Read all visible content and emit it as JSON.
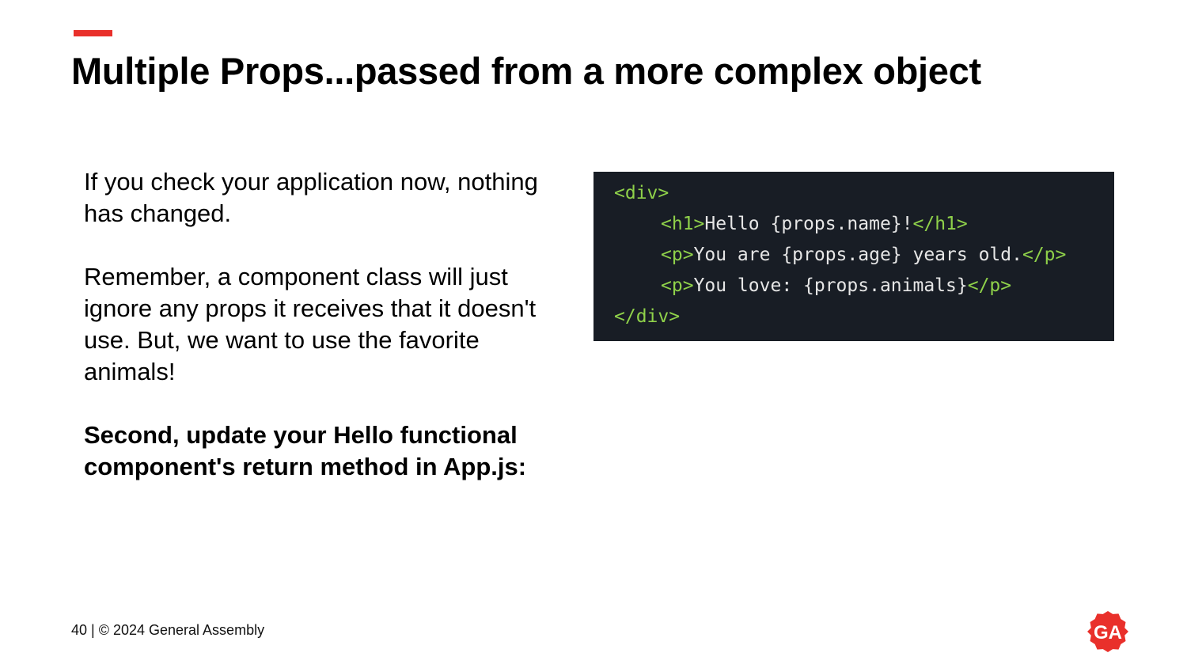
{
  "slide": {
    "title": "Multiple Props...passed from a more complex object",
    "paragraphs": [
      "If you check your application now, nothing has changed.",
      "Remember, a component class will just ignore any props it receives that it doesn't use. But, we want to use the favorite animals!"
    ],
    "instruction": "Second, update your Hello functional component's return method in App.js:"
  },
  "code": {
    "line1_open": "<div>",
    "line2_open": "<h1>",
    "line2_text": "Hello {props.name}!",
    "line2_close": "</h1>",
    "line3_open": "<p>",
    "line3_text": "You are {props.age} years old.",
    "line3_close": "</p>",
    "line4_open": "<p>",
    "line4_text": "You love: {props.animals}",
    "line4_close": "</p>",
    "line5_close": "</div>"
  },
  "footer": {
    "text": "40 | © 2024 General Assembly"
  },
  "logo": {
    "icon": "ga-logo-icon",
    "text": "GA"
  },
  "colors": {
    "accent": "#e9302b",
    "code_background": "#181d25",
    "code_tag": "#8fd14a",
    "code_text": "#e6e6e6"
  }
}
